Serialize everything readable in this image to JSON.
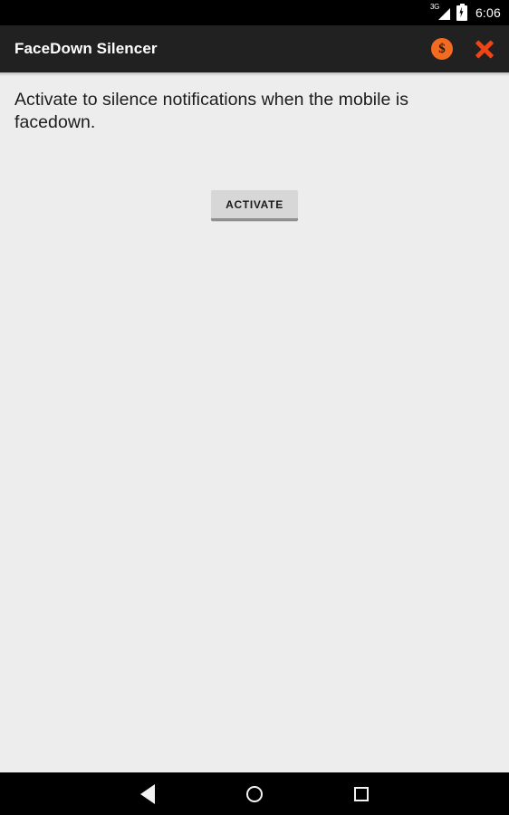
{
  "status_bar": {
    "network_label": "3G",
    "signal_icon": "signal-3g-icon",
    "battery_icon": "battery-charging-icon",
    "time": "6:06"
  },
  "app_bar": {
    "title": "FaceDown Silencer",
    "actions": [
      {
        "name": "monetize-coin-icon",
        "glyph": "$",
        "color": "#f26b21"
      },
      {
        "name": "close-icon",
        "glyph": "✕",
        "color": "#ef4413"
      }
    ]
  },
  "main": {
    "description": "Activate to silence notifications when the mobile is facedown.",
    "activate_button_label": "ACTIVATE"
  },
  "nav_bar": {
    "back_label": "Back",
    "home_label": "Home",
    "recents_label": "Recents"
  },
  "colors": {
    "status_bar": "#000000",
    "app_bar": "#212121",
    "content_background": "#ededed",
    "accent_orange": "#f26b21",
    "close_red": "#ef4413",
    "button_face": "#d6d7d6"
  }
}
